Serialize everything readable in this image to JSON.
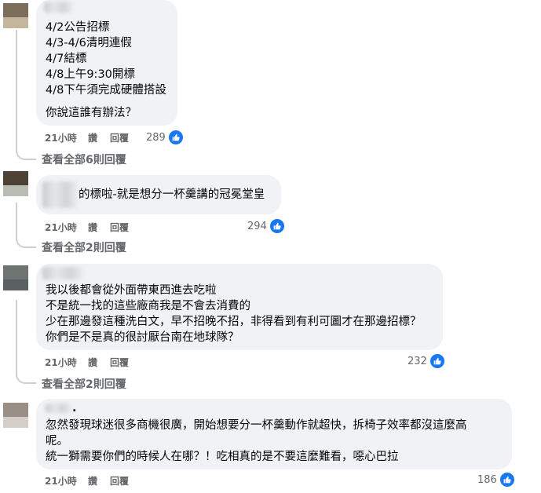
{
  "comments": [
    {
      "lines": [
        "4/2公告招標",
        "4/3-4/6清明連假",
        "4/7結標",
        "4/8上午9:30開標",
        "4/8下午須完成硬體搭設",
        "",
        "你說這誰有辦法？"
      ],
      "time": "21小時",
      "like": "讚",
      "reply": "回覆",
      "reactions": "289",
      "view_replies": "查看全部6則回覆"
    },
    {
      "lines": [
        "的標啦-就是想分一杯羹講的冠冕堂皇"
      ],
      "time": "21小時",
      "like": "讚",
      "reply": "回覆",
      "reactions": "294",
      "view_replies": "查看全部2則回覆"
    },
    {
      "lines": [
        "我以後都會從外面帶東西進去吃啦",
        "不是統一找的這些廠商我是不會去消費的",
        "少在那邊發這種洗白文，早不招晚不招，非得看到有利可圖才在那邊招標？",
        "你們是不是真的很討厭台南在地球隊？"
      ],
      "time": "21小時",
      "like": "讚",
      "reply": "回覆",
      "reactions": "232",
      "view_replies": "查看全部2則回覆"
    },
    {
      "author_tail": ".",
      "lines": [
        "忽然發現球迷很多商機很廣，開始想要分一杯羹動作就超快，拆椅子效率都沒這麼高",
        "呢。",
        "統一獅需要你們的時候人在哪？！吃相真的是不要這麼難看，噁心巴拉"
      ],
      "time": "21小時",
      "like": "讚",
      "reply": "回覆",
      "reactions": "186"
    }
  ],
  "colors": {
    "bubble": "#f0f2f5",
    "meta": "#65676b",
    "like": "#1877f2"
  }
}
